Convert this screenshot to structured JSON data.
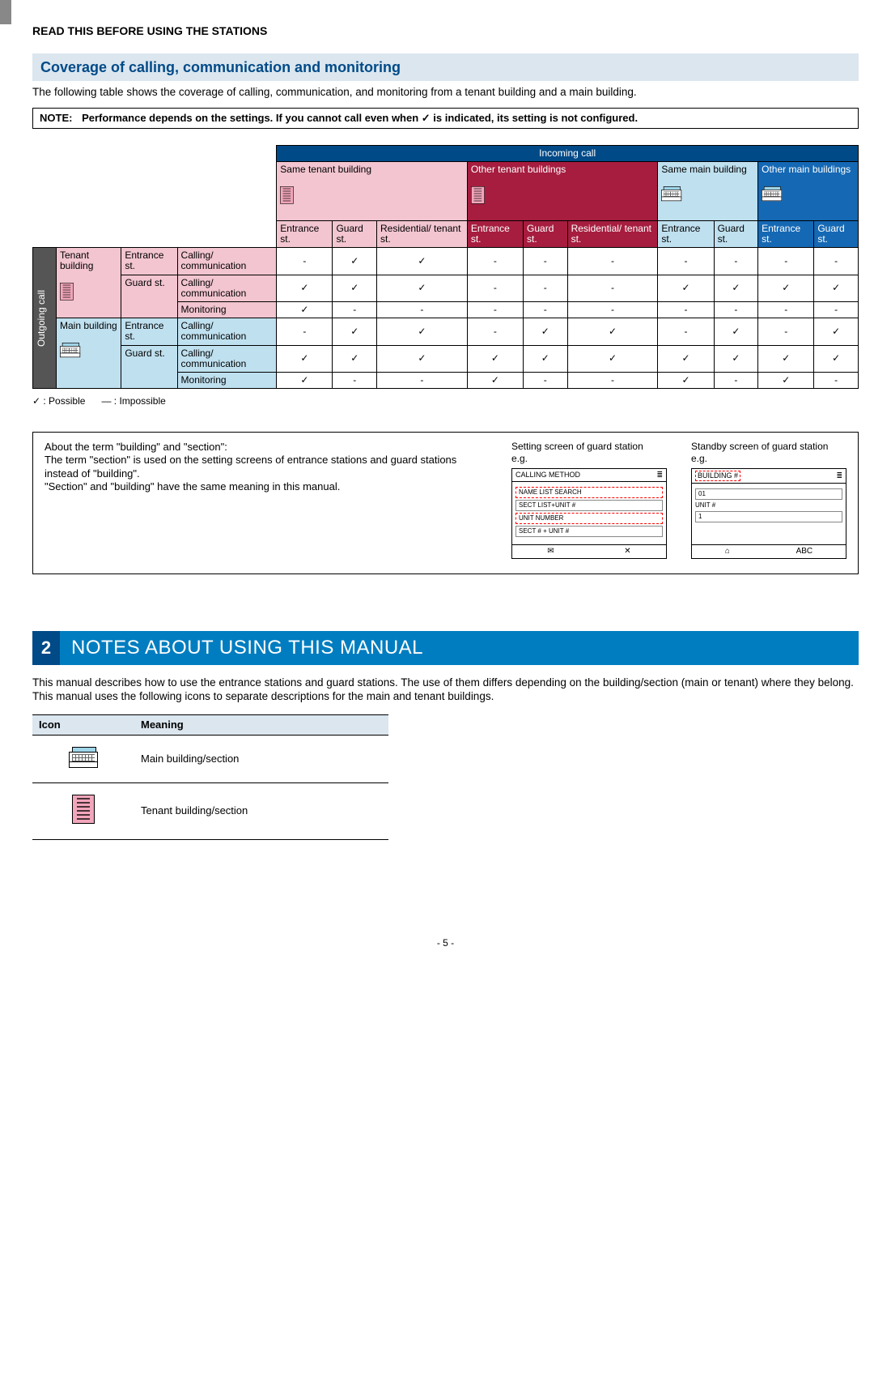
{
  "running_head": "READ THIS BEFORE USING THE STATIONS",
  "sub_heading": "Coverage of calling, communication and monitoring",
  "intro": "The following table shows the coverage of calling, communication, and monitoring from a tenant building and a main building.",
  "note_label": "NOTE:",
  "note_text": "Performance depends on the settings. If you cannot call even when ✓ is indicated, its setting is not configured.",
  "table": {
    "top_header": "Incoming call",
    "groups": [
      {
        "label": "Same tenant building",
        "cls": "bg-pink",
        "cols": [
          "Entrance st.",
          "Guard st.",
          "Residential/ tenant st."
        ]
      },
      {
        "label": "Other tenant buildings",
        "cls": "bg-crimson",
        "cols": [
          "Entrance st.",
          "Guard st.",
          "Residential/ tenant st."
        ]
      },
      {
        "label": "Same main building",
        "cls": "bg-blue-light",
        "cols": [
          "Entrance st.",
          "Guard st."
        ]
      },
      {
        "label": "Other main buildings",
        "cls": "bg-blue-mid",
        "cols": [
          "Entrance st.",
          "Guard st."
        ]
      }
    ],
    "side_label": "Outgoing call",
    "row_groups": [
      {
        "origin": "Tenant building",
        "origin_cls": "bg-pink",
        "rows": [
          {
            "station": "Entrance st.",
            "action": "Calling/ communication",
            "cells": [
              "-",
              "✓",
              "✓",
              "-",
              "-",
              "-",
              "-",
              "-",
              "-",
              "-"
            ]
          },
          {
            "station": "Guard st.",
            "action": "Calling/ communication",
            "cells": [
              "✓",
              "✓",
              "✓",
              "-",
              "-",
              "-",
              "✓",
              "✓",
              "✓",
              "✓"
            ]
          },
          {
            "station": "",
            "action": "Monitoring",
            "cells": [
              "✓",
              "-",
              "-",
              "-",
              "-",
              "-",
              "-",
              "-",
              "-",
              "-"
            ]
          }
        ]
      },
      {
        "origin": "Main building",
        "origin_cls": "bg-blue-light",
        "rows": [
          {
            "station": "Entrance st.",
            "action": "Calling/ communication",
            "cells": [
              "-",
              "✓",
              "✓",
              "-",
              "✓",
              "✓",
              "-",
              "✓",
              "-",
              "✓"
            ]
          },
          {
            "station": "Guard st.",
            "action": "Calling/ communication",
            "cells": [
              "✓",
              "✓",
              "✓",
              "✓",
              "✓",
              "✓",
              "✓",
              "✓",
              "✓",
              "✓"
            ]
          },
          {
            "station": "",
            "action": "Monitoring",
            "cells": [
              "✓",
              "-",
              "-",
              "✓",
              "-",
              "-",
              "✓",
              "-",
              "✓",
              "-"
            ]
          }
        ]
      }
    ]
  },
  "legend": {
    "possible": "✓ : Possible",
    "impossible": "— : Impossible"
  },
  "term_box": {
    "title": "About the term \"building\" and \"section\":",
    "body1": "The term \"section\" is used on the setting screens of entrance stations and guard stations instead of \"building\".",
    "body2": "\"Section\" and \"building\" have the same meaning in this manual.",
    "shot1_caption": "Setting screen of guard station",
    "shot2_caption": "Standby screen of guard station",
    "eg": "e.g.",
    "shot1": {
      "title": "CALLING METHOD",
      "rows": [
        "NAME LIST SEARCH",
        "SECT LIST+UNIT #",
        "UNIT NUMBER",
        "SECT # + UNIT #"
      ],
      "footer_left": "✉",
      "footer_right": "✕"
    },
    "shot2": {
      "title": "BUILDING #",
      "rows": [
        "01",
        "UNIT #",
        "1"
      ],
      "footer_left": "⌂",
      "footer_right": "ABC"
    }
  },
  "chapter": {
    "num": "2",
    "title": "NOTES ABOUT USING THIS MANUAL",
    "para": "This manual describes how to use the entrance stations and guard stations. The use of them differs depending on the building/section (main or tenant) where they belong. This manual uses the following icons to separate descriptions for the main and tenant buildings."
  },
  "icon_table": {
    "head_icon": "Icon",
    "head_meaning": "Meaning",
    "rows": [
      {
        "meaning": "Main building/section",
        "kind": "main"
      },
      {
        "meaning": "Tenant building/section",
        "kind": "tenant"
      }
    ]
  },
  "page_num": "- 5 -",
  "chart_data": {
    "type": "table",
    "title": "Coverage of calling, communication and monitoring — ✓=Possible, –=Impossible",
    "columns": [
      "Same tenant / Entrance st.",
      "Same tenant / Guard st.",
      "Same tenant / Residential-tenant st.",
      "Other tenant / Entrance st.",
      "Other tenant / Guard st.",
      "Other tenant / Residential-tenant st.",
      "Same main / Entrance st.",
      "Same main / Guard st.",
      "Other main / Entrance st.",
      "Other main / Guard st."
    ],
    "rows": [
      {
        "label": "Tenant building — Entrance st. — Calling/communication",
        "values": [
          "-",
          "✓",
          "✓",
          "-",
          "-",
          "-",
          "-",
          "-",
          "-",
          "-"
        ]
      },
      {
        "label": "Tenant building — Guard st. — Calling/communication",
        "values": [
          "✓",
          "✓",
          "✓",
          "-",
          "-",
          "-",
          "✓",
          "✓",
          "✓",
          "✓"
        ]
      },
      {
        "label": "Tenant building — Guard st. — Monitoring",
        "values": [
          "✓",
          "-",
          "-",
          "-",
          "-",
          "-",
          "-",
          "-",
          "-",
          "-"
        ]
      },
      {
        "label": "Main building — Entrance st. — Calling/communication",
        "values": [
          "-",
          "✓",
          "✓",
          "-",
          "✓",
          "✓",
          "-",
          "✓",
          "-",
          "✓"
        ]
      },
      {
        "label": "Main building — Guard st. — Calling/communication",
        "values": [
          "✓",
          "✓",
          "✓",
          "✓",
          "✓",
          "✓",
          "✓",
          "✓",
          "✓",
          "✓"
        ]
      },
      {
        "label": "Main building — Guard st. — Monitoring",
        "values": [
          "✓",
          "-",
          "-",
          "✓",
          "-",
          "-",
          "✓",
          "-",
          "✓",
          "-"
        ]
      }
    ]
  }
}
